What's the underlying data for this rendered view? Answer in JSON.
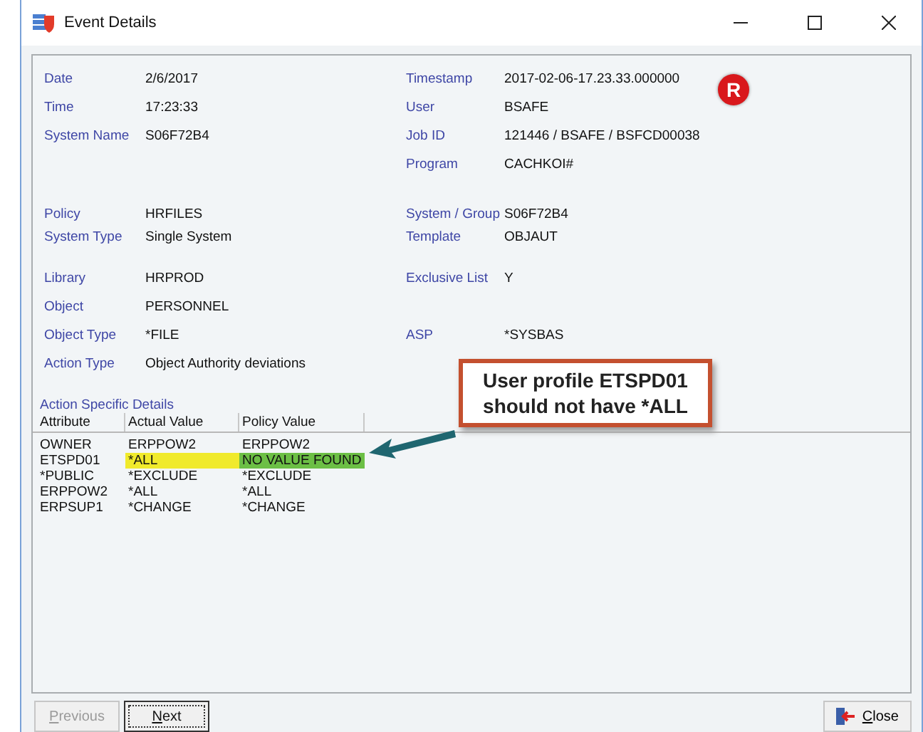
{
  "window": {
    "title": "Event Details"
  },
  "groups": [
    {
      "rows": [
        {
          "left": {
            "label": "Date",
            "value": "2/6/2017"
          },
          "right": {
            "label": "Timestamp",
            "value": "2017-02-06-17.23.33.000000"
          }
        },
        {
          "left": {
            "label": "Time",
            "value": "17:23:33"
          },
          "right": {
            "label": "User",
            "value": "BSAFE"
          }
        },
        {
          "left": {
            "label": "System Name",
            "value": "S06F72B4"
          },
          "right": {
            "label": "Job ID",
            "value": "121446 / BSAFE / BSFCD00038"
          }
        },
        {
          "right": {
            "label": "Program",
            "value": "CACHKOI#"
          }
        }
      ]
    },
    {
      "rows": [
        {
          "left": {
            "label": "Policy",
            "value": "HRFILES"
          },
          "right": {
            "label": "System / Group",
            "value": "S06F72B4"
          }
        },
        {
          "left": {
            "label": "System Type",
            "value": "Single System"
          },
          "right": {
            "label": "Template",
            "value": "OBJAUT"
          }
        }
      ]
    },
    {
      "rows": [
        {
          "left": {
            "label": "Library",
            "value": "HRPROD"
          },
          "right": {
            "label": "Exclusive List",
            "value": "Y"
          }
        },
        {
          "left": {
            "label": "Object",
            "value": "PERSONNEL"
          }
        },
        {
          "left": {
            "label": "Object Type",
            "value": "*FILE"
          },
          "right": {
            "label": "ASP",
            "value": "*SYSBAS"
          }
        },
        {
          "left": {
            "label": "Action Type",
            "value": "Object Authority deviations"
          }
        }
      ]
    }
  ],
  "badge": "R",
  "details": {
    "title": "Action Specific Details",
    "columns": [
      "Attribute",
      "Actual Value",
      "Policy Value"
    ],
    "rows": [
      {
        "cells": [
          {
            "text": "OWNER"
          },
          {
            "text": "ERPPOW2"
          },
          {
            "text": "ERPPOW2"
          }
        ]
      },
      {
        "cells": [
          {
            "text": "ETSPD01"
          },
          {
            "text": "*ALL",
            "color": "#f0ea2c"
          },
          {
            "text": "NO VALUE FOUND",
            "color": "#6cbf45"
          }
        ]
      },
      {
        "cells": [
          {
            "text": "*PUBLIC"
          },
          {
            "text": "*EXCLUDE"
          },
          {
            "text": "*EXCLUDE"
          }
        ]
      },
      {
        "cells": [
          {
            "text": "ERPPOW2"
          },
          {
            "text": "*ALL"
          },
          {
            "text": "*ALL"
          }
        ]
      },
      {
        "cells": [
          {
            "text": "ERPSUP1"
          },
          {
            "text": "*CHANGE"
          },
          {
            "text": "*CHANGE"
          }
        ]
      }
    ]
  },
  "callout": {
    "lines": [
      "User profile ETSPD01",
      "should not have *ALL"
    ]
  },
  "buttons": [
    {
      "label": "Previous",
      "disabled": true,
      "focused": false
    },
    {
      "label": "Next",
      "disabled": false,
      "focused": true
    }
  ],
  "close": {
    "label": "Close"
  }
}
